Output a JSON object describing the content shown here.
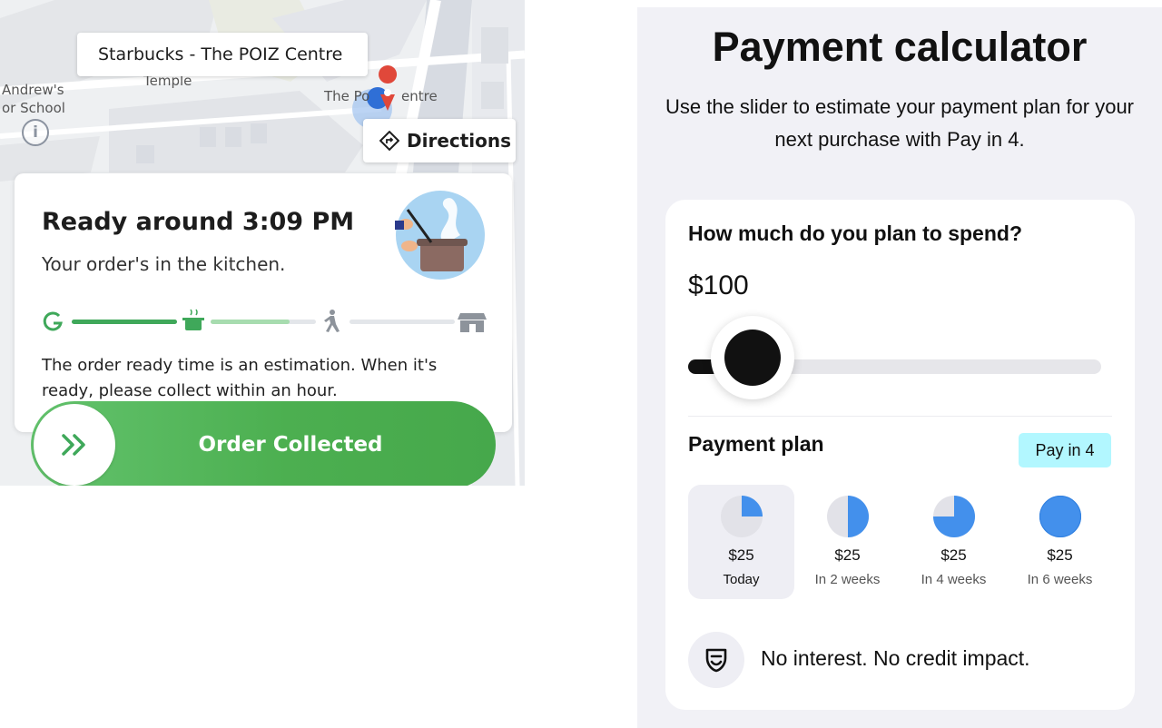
{
  "grab": {
    "store_label": "Starbucks - The POIZ Centre",
    "map_labels": [
      "Andrew's",
      "or School",
      "Temple",
      "The Po",
      "entre"
    ],
    "directions_label": "Directions",
    "ready_title": "Ready around 3:09 PM",
    "ready_subtitle": "Your order's in the kitchen.",
    "note": "The order ready time is an estimation. When it's ready, please collect within an hour.",
    "collect_label": "Order Collected",
    "colors": {
      "accent": "#4caf50",
      "progress_done": "#3fa85a",
      "progress_partial": "#a7dcaf",
      "progress_todo": "#e3e6ea"
    },
    "progress": {
      "step1_fill": 1.0,
      "step2_fill": 0.75,
      "step3_fill": 0.0
    },
    "steps": [
      "grab-logo-icon",
      "cooking-pot-icon",
      "walking-person-icon",
      "store-icon"
    ]
  },
  "calc": {
    "title": "Payment calculator",
    "description": "Use the slider to estimate your payment plan for your next purchase with Pay in 4.",
    "question": "How much do you plan to spend?",
    "amount": "$100",
    "slider_fraction": 0.06,
    "plan_label": "Payment plan",
    "badge": "Pay in 4",
    "installments": [
      {
        "amount": "$25",
        "when": "Today",
        "fraction": 0.25,
        "active": true
      },
      {
        "amount": "$25",
        "when": "In 2 weeks",
        "fraction": 0.5,
        "active": false
      },
      {
        "amount": "$25",
        "when": "In 4 weeks",
        "fraction": 0.75,
        "active": false
      },
      {
        "amount": "$25",
        "when": "In 6 weeks",
        "fraction": 1.0,
        "active": false
      }
    ],
    "footer": "No interest. No credit impact.",
    "colors": {
      "pie_fill": "#4390ec",
      "pie_empty": "#e2e2e8",
      "badge_bg": "#b2f7ff"
    }
  }
}
